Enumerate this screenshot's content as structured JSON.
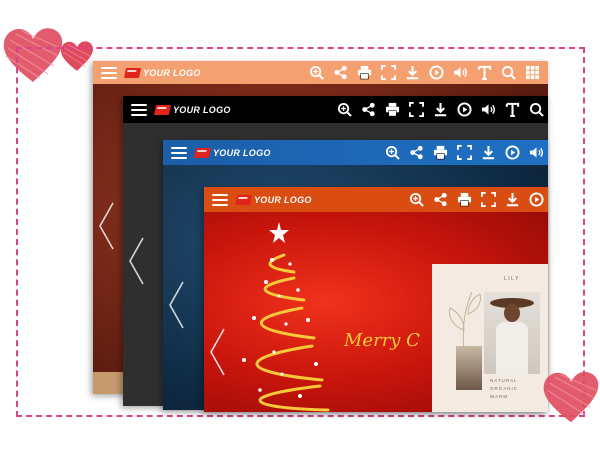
{
  "colors": {
    "frame_dash": "#d9448a",
    "toolbar_1": "#f4a070",
    "toolbar_2": "#000000",
    "toolbar_3": "#1f66b8",
    "toolbar_4": "#d94c12",
    "logo_text_light": "#ffffff",
    "logo_text_dark": "#e33b12",
    "heart": "#e04a5e"
  },
  "windows": [
    {
      "logo_text": "YOUR LOGO",
      "icons": [
        "zoom-in-icon",
        "share-icon",
        "print-icon",
        "fullscreen-icon",
        "download-icon",
        "autoplay-icon",
        "sound-icon",
        "text-icon",
        "search-icon",
        "thumbnails-icon"
      ]
    },
    {
      "logo_text": "YOUR LOGO",
      "icons": [
        "zoom-in-icon",
        "share-icon",
        "print-icon",
        "fullscreen-icon",
        "download-icon",
        "autoplay-icon",
        "sound-icon",
        "text-icon",
        "search-icon"
      ]
    },
    {
      "logo_text": "YOUR LOGO",
      "icons": [
        "zoom-in-icon",
        "share-icon",
        "print-icon",
        "fullscreen-icon",
        "download-icon",
        "autoplay-icon",
        "sound-icon"
      ]
    },
    {
      "logo_text": "YOUR LOGO",
      "icons": [
        "zoom-in-icon",
        "share-icon",
        "print-icon",
        "fullscreen-icon",
        "download-icon",
        "autoplay-icon"
      ]
    }
  ],
  "greeting": {
    "text": "Merry C"
  },
  "magazine": {
    "title": "LILY",
    "tags": [
      "NATURAL",
      "ORGANIC",
      "WARM"
    ]
  }
}
